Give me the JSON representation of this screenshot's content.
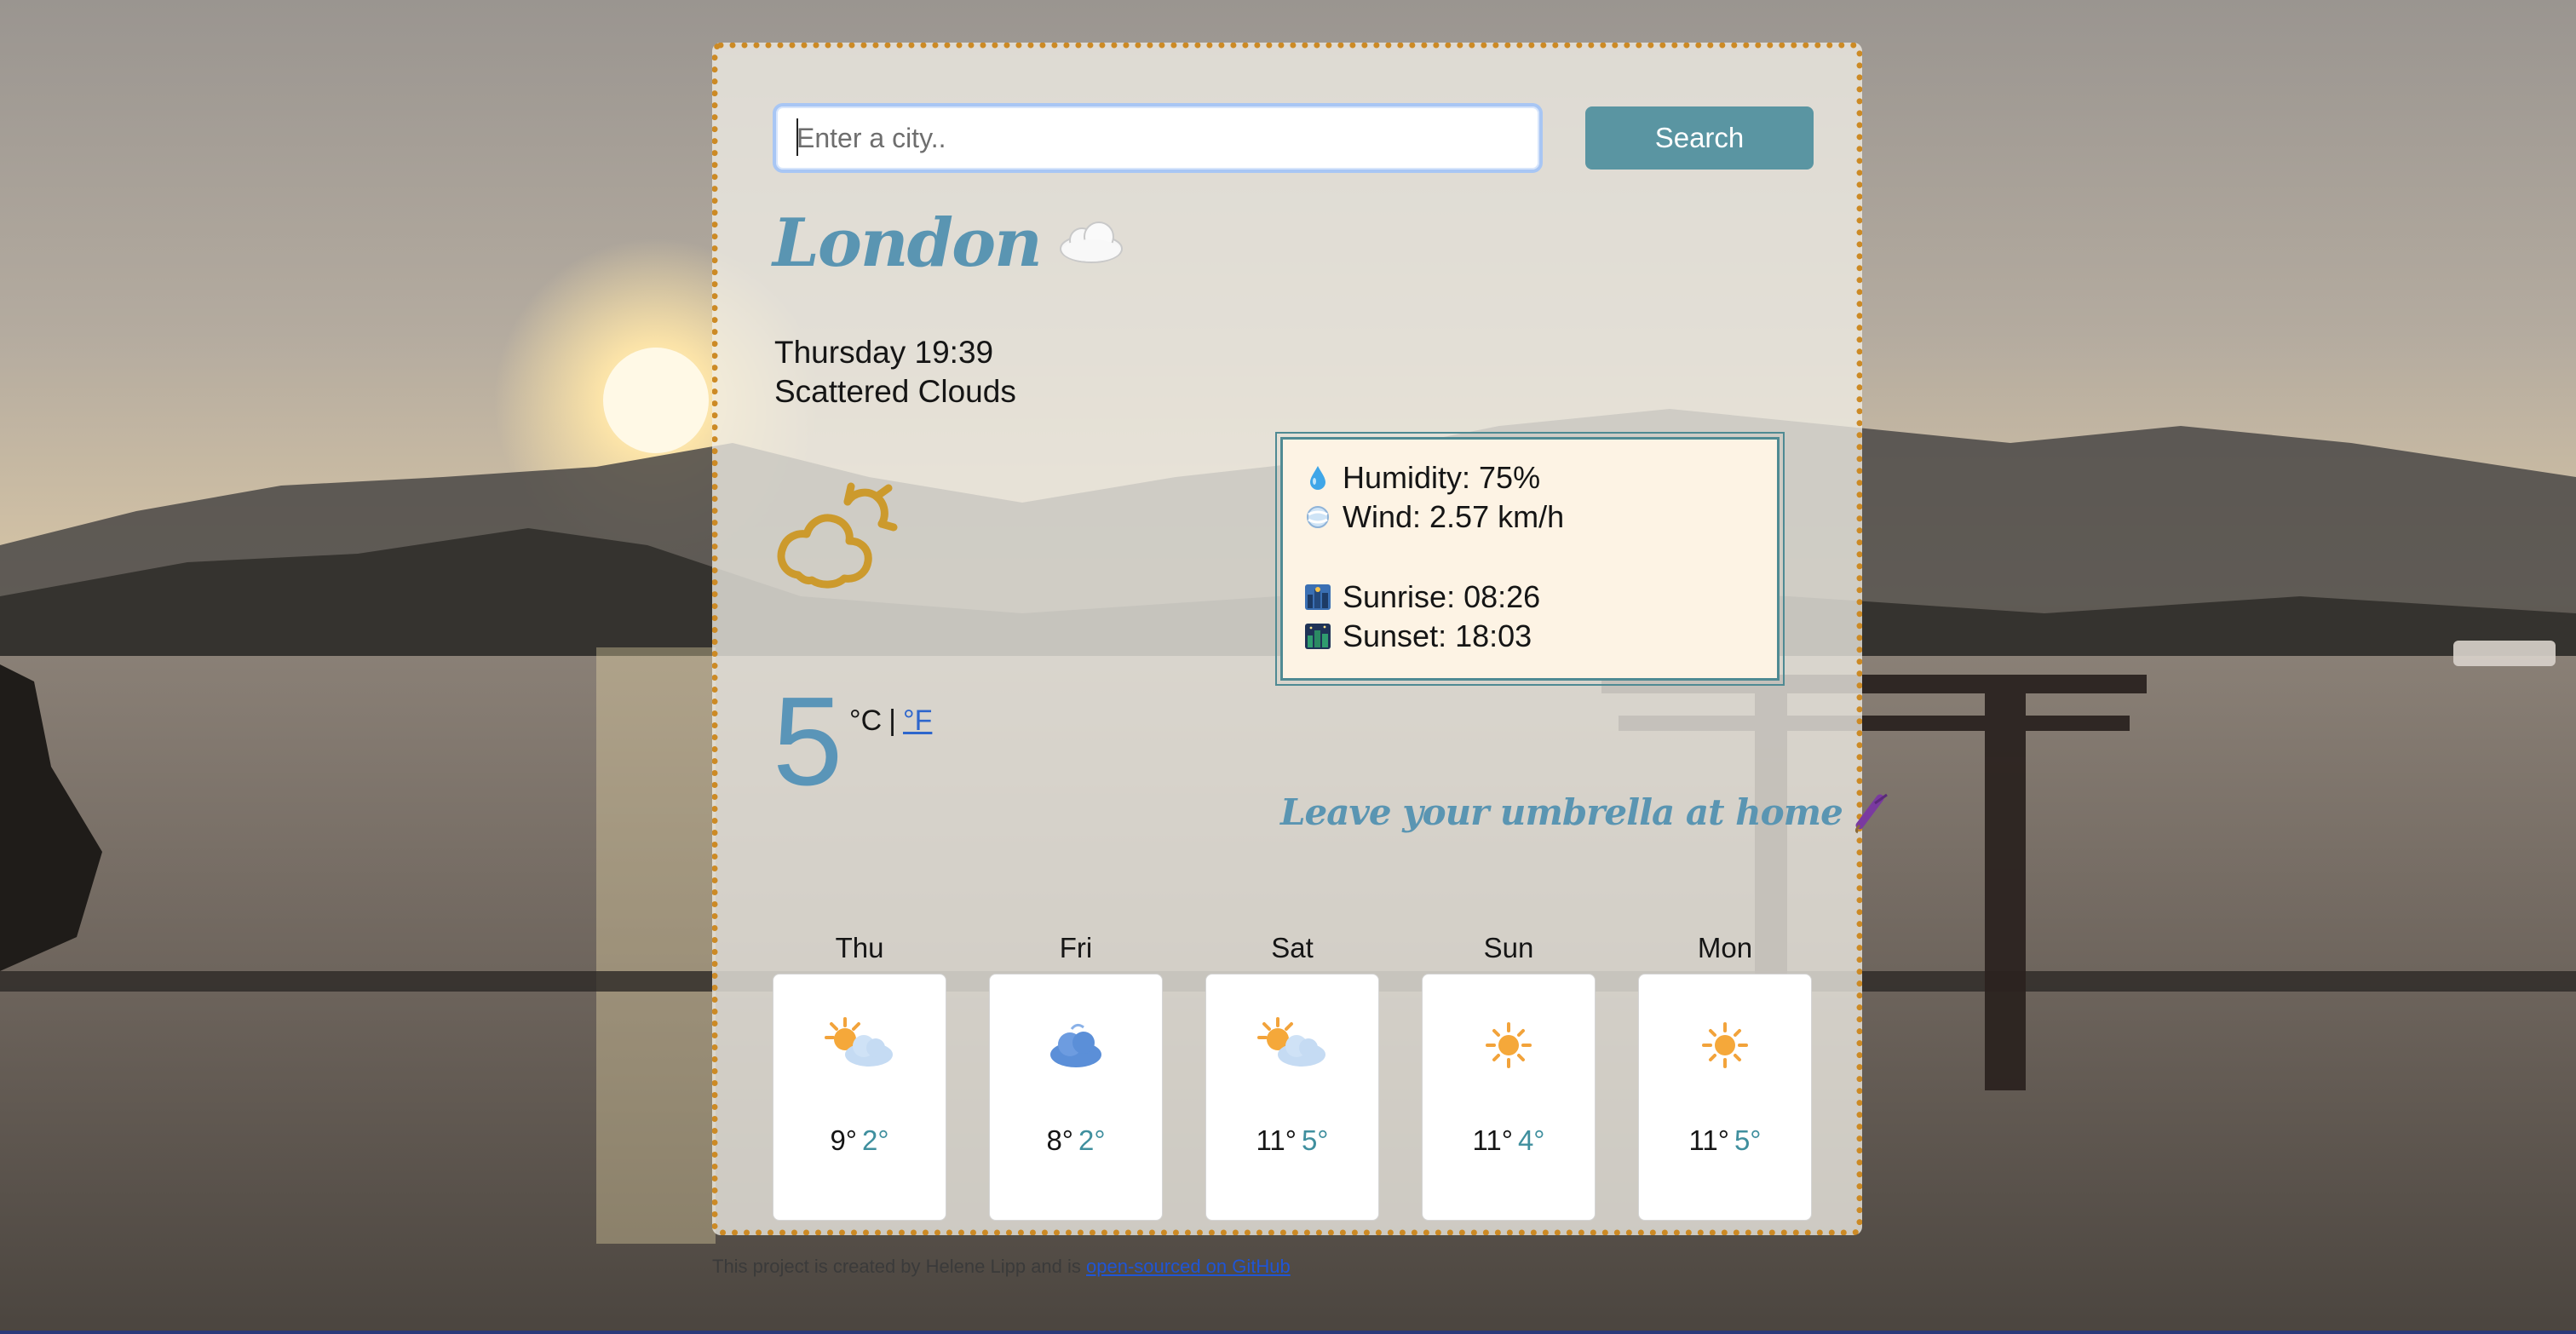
{
  "search": {
    "placeholder": "Enter a city..",
    "button_label": "Search"
  },
  "current": {
    "city": "London",
    "condition_icon": "cloud-icon",
    "datetime": "Thursday 19:39",
    "description": "Scattered Clouds",
    "main_icon": "sun-behind-cloud-outline-icon",
    "temperature": "5",
    "unit_celsius": "°C",
    "unit_separator": "|",
    "unit_fahrenheit": "°F"
  },
  "details": {
    "humidity": "Humidity: 75%",
    "wind": "Wind: 2.57 km/h",
    "sunrise": "Sunrise: 08:26",
    "sunset": "Sunset: 18:03"
  },
  "umbrella_message": "Leave your umbrella at home",
  "forecast": [
    {
      "day": "Thu",
      "icon": "sun-behind-cloud-icon",
      "high": "9°",
      "low": "2°"
    },
    {
      "day": "Fri",
      "icon": "cloud-icon",
      "high": "8°",
      "low": "2°"
    },
    {
      "day": "Sat",
      "icon": "sun-behind-cloud-icon",
      "high": "11°",
      "low": "5°"
    },
    {
      "day": "Sun",
      "icon": "sun-icon",
      "high": "11°",
      "low": "4°"
    },
    {
      "day": "Mon",
      "icon": "sun-icon",
      "high": "11°",
      "low": "5°"
    }
  ],
  "footer": {
    "text": "This project is created by Helene Lipp and is",
    "link_text": "open-sourced on GitHub"
  },
  "colors": {
    "accent": "#5a95b2",
    "button": "#5a95a2",
    "card_border": "#cc8a25",
    "details_bg": "#fdf3e4",
    "low_temp": "#3f8f9e"
  }
}
